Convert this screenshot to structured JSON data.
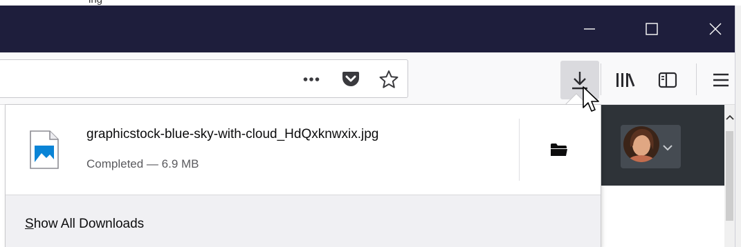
{
  "top_strip": {
    "text": "ing"
  },
  "window": {
    "titlebar_color": "#1e1e3c",
    "controls": [
      {
        "name": "minimize",
        "icon": "minimize-icon"
      },
      {
        "name": "maximize",
        "icon": "maximize-icon"
      },
      {
        "name": "close",
        "icon": "close-icon"
      }
    ]
  },
  "toolbar": {
    "url_actions": [
      "page-actions-icon",
      "pocket-icon",
      "bookmark-star-icon"
    ],
    "buttons": [
      "downloads-icon",
      "library-icon",
      "sidebar-icon",
      "menu-icon"
    ]
  },
  "downloads_panel": {
    "items": [
      {
        "file_name": "graphicstock-blue-sky-with-cloud_HdQxknwxix.jpg",
        "status": "Completed — 6.9 MB",
        "icon": "image-file-icon",
        "action_icon": "open-folder-icon"
      }
    ],
    "footer": {
      "accesskey_letter": "S",
      "label_rest": "how All Downloads"
    }
  },
  "page": {
    "header_color": "#2e3338",
    "avatar": "user-avatar"
  }
}
